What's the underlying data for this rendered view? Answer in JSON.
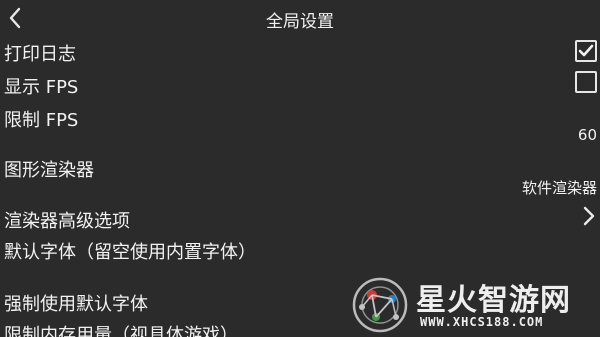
{
  "header": {
    "title": "全局设置"
  },
  "settings": {
    "print_log": {
      "label": "打印日志",
      "checked": true
    },
    "show_fps": {
      "label": "显示 FPS",
      "checked": false
    },
    "limit_fps": {
      "label": "限制 FPS",
      "value": "60"
    },
    "renderer": {
      "label": "图形渲染器",
      "value": "软件渲染器"
    },
    "renderer_advanced": {
      "label": "渲染器高级选项"
    },
    "default_font": {
      "label": "默认字体（留空使用内置字体）"
    },
    "force_default_font": {
      "label": "强制使用默认字体"
    },
    "memory_limit": {
      "label": "限制内存用量（视具体游戏）"
    }
  },
  "watermark": {
    "name": "星火智游网",
    "url": "WWW.XHCS188.COM"
  },
  "icons": {
    "back": "chevron-left-icon",
    "check": "checkmark-icon",
    "more": "chevron-right-icon",
    "logo": "network-logo-icon"
  }
}
